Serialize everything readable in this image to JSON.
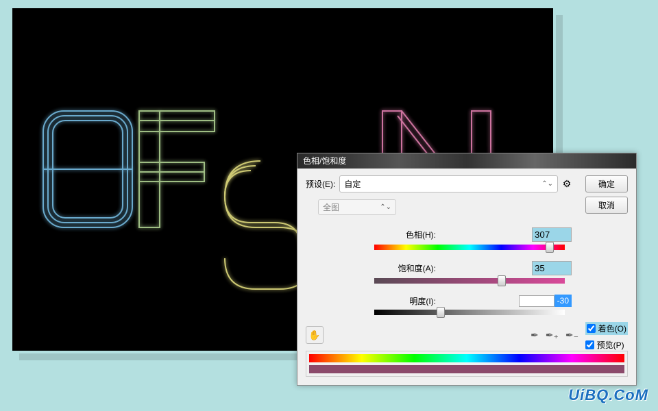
{
  "canvas": {
    "text_art": "DESIGN"
  },
  "dialog": {
    "title": "色相/饱和度",
    "preset_label": "预设(E):",
    "preset_value": "自定",
    "scope_value": "全图",
    "hue": {
      "label": "色相(H):",
      "value": "307"
    },
    "saturation": {
      "label": "饱和度(A):",
      "value": "35"
    },
    "lightness": {
      "label": "明度(I):",
      "value": "-30"
    },
    "ok": "确定",
    "cancel": "取消",
    "colorize": "着色(O)",
    "preview": "预览(P)"
  },
  "watermark": "UiBQ.CoM"
}
